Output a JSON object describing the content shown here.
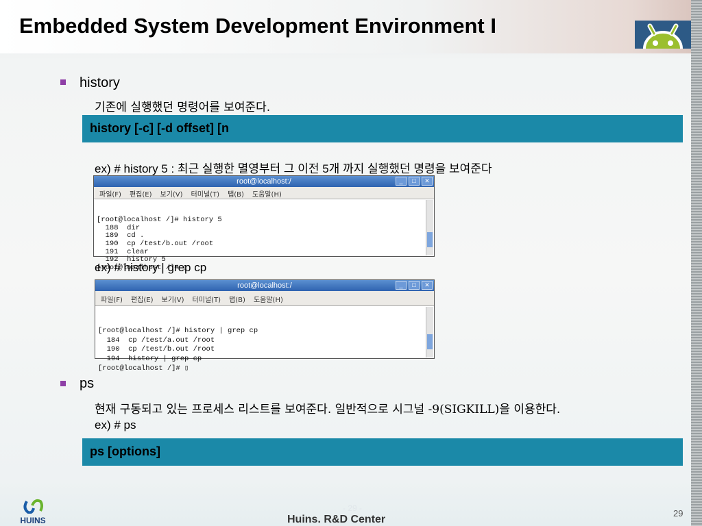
{
  "title": "Embedded System Development Environment I",
  "sections": [
    {
      "bullet": "history",
      "desc": "기존에 실행했던 명령어를 보여준다.",
      "syntax": "history [-c] [-d offset] [n",
      "examples": [
        {
          "label": "ex) # history 5  :  최근 실행한 멸영부터 그 이전 5개 까지 실행했던 명령을 보여준다",
          "terminal": {
            "title": "root@localhost:/",
            "menu": [
              "파일(F)",
              "편집(E)",
              "보기(V)",
              "터미널(T)",
              "탭(B)",
              "도움말(H)"
            ],
            "lines": [
              "[root@localhost /]# history 5",
              "  188  dir",
              "  189  cd .",
              "  190  cp /test/b.out /root",
              "  191  clear",
              "  192  history 5",
              "[root@localhost /]# ▯"
            ]
          }
        },
        {
          "label": "ex) # history | grep cp",
          "terminal": {
            "title": "root@localhost:/",
            "menu": [
              "파일(F)",
              "편집(E)",
              "보기(V)",
              "터미널(T)",
              "탭(B)",
              "도움말(H)"
            ],
            "lines": [
              "[root@localhost /]# history | grep cp",
              "  184  cp /test/a.out /root",
              "  190  cp /test/b.out /root",
              "  194  history | grep cp",
              "[root@localhost /]# ▯"
            ]
          }
        }
      ]
    },
    {
      "bullet": "ps",
      "desc": "현재 구동되고 있는 프로세스 리스트를 보여준다. 일반적으로 시그널 -9(SIGKILL)을 이용한다.",
      "example": "ex) # ps",
      "syntax": "ps [options]"
    }
  ],
  "footer": {
    "company": "HUINS",
    "center": "Huins. R&D Center",
    "page_faint": "- 29 -",
    "page": "29"
  },
  "colors": {
    "accent_box": "#1b89a8",
    "bullet": "#8e3fa6"
  }
}
